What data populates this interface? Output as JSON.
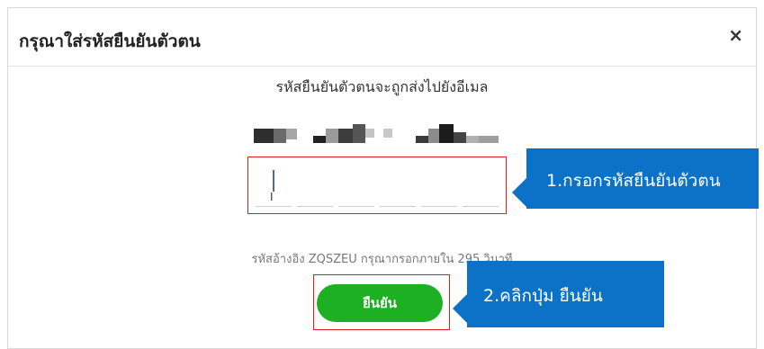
{
  "modal": {
    "title": "กรุณาใส่รหัสยืนยันตัวตน",
    "close_label": "×",
    "instruction": "รหัสยืนยันตัวตนจะถูกส่งไปยังอีเมล",
    "ref_text": "รหัสอ้างอิง ZQSZEU กรุณากรอกภายใน 295 วินาที",
    "confirm_label": "ยืนยัน"
  },
  "annotations": {
    "step1": "1.กรอกรหัสยืนยันตัวตน",
    "step2": "2.คลิกปุ่ม ยืนยัน"
  },
  "colors": {
    "confirm_button": "#1db022",
    "callout": "#0b72c8",
    "highlight": "#e02020"
  }
}
